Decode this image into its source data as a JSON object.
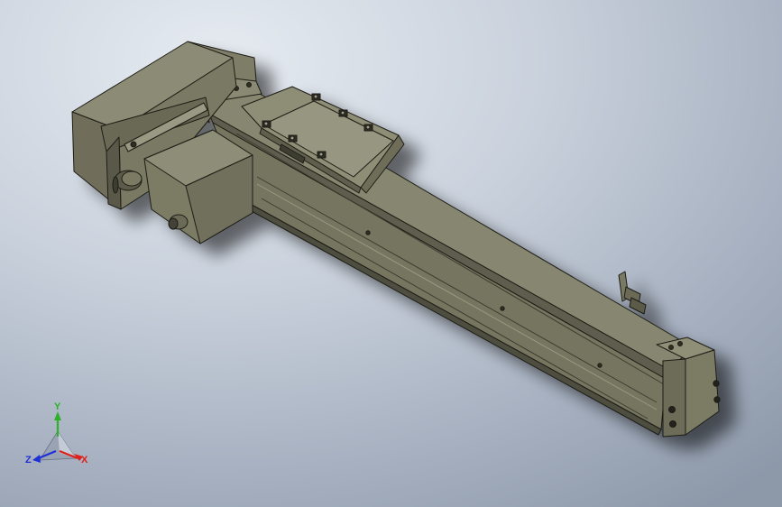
{
  "triad": {
    "x_label": "X",
    "y_label": "Y",
    "z_label": "Z",
    "x_color": "#e0201a",
    "y_color": "#2fb02a",
    "z_color": "#2030d8"
  },
  "model": {
    "description_icon": "linear-actuator-model",
    "body_color": "#7e7d68",
    "edge_color": "#1e1e16"
  }
}
